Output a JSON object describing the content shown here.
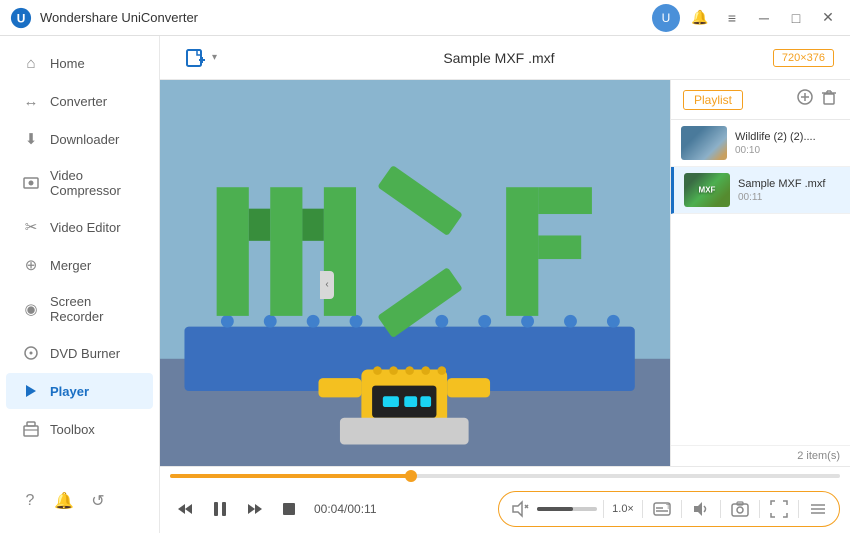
{
  "titlebar": {
    "app_name": "Wondershare UniConverter",
    "user_icon_label": "U",
    "btn_minimize": "─",
    "btn_maximize": "□",
    "btn_close": "✕",
    "btn_notification": "🔔",
    "btn_menu": "≡"
  },
  "sidebar": {
    "items": [
      {
        "id": "home",
        "label": "Home",
        "icon": "⌂",
        "active": false
      },
      {
        "id": "converter",
        "label": "Converter",
        "icon": "↔",
        "active": false
      },
      {
        "id": "downloader",
        "label": "Downloader",
        "icon": "⬇",
        "active": false
      },
      {
        "id": "video-compressor",
        "label": "Video Compressor",
        "icon": "⊞",
        "active": false
      },
      {
        "id": "video-editor",
        "label": "Video Editor",
        "icon": "✂",
        "active": false
      },
      {
        "id": "merger",
        "label": "Merger",
        "icon": "⊕",
        "active": false
      },
      {
        "id": "screen-recorder",
        "label": "Screen Recorder",
        "icon": "◉",
        "active": false
      },
      {
        "id": "dvd-burner",
        "label": "DVD Burner",
        "icon": "💿",
        "active": false
      },
      {
        "id": "player",
        "label": "Player",
        "icon": "▶",
        "active": true
      },
      {
        "id": "toolbox",
        "label": "Toolbox",
        "icon": "⊞",
        "active": false
      }
    ],
    "bottom_icons": [
      "?",
      "🔔",
      "↺"
    ]
  },
  "toolbar": {
    "add_file_icon": "⬆",
    "title": "Sample MXF .mxf",
    "resolution_badge": "720×376"
  },
  "playlist": {
    "tab_label": "Playlist",
    "count_label": "2 item(s)",
    "items": [
      {
        "name": "Wildlife (2) (2)....",
        "duration": "00:10",
        "active": false,
        "thumb_type": "wildlife"
      },
      {
        "name": "Sample MXF .mxf",
        "duration": "00:11",
        "active": true,
        "thumb_type": "mxf"
      }
    ]
  },
  "player": {
    "time_current": "00:04",
    "time_total": "00:11",
    "time_display": "00:04/00:11",
    "progress_percent": 36,
    "volume_percent": 60,
    "speed_label": "1.0×",
    "controls": {
      "prev": "⏮",
      "play_pause": "⏸",
      "next": "⏭",
      "stop": "⏹",
      "volume_mute": "🔇",
      "speed": "1.0×",
      "subtitle": "T",
      "audio": "🔉",
      "snapshot": "⊡",
      "fullscreen": "⛶",
      "playlist_toggle": "☰"
    }
  }
}
